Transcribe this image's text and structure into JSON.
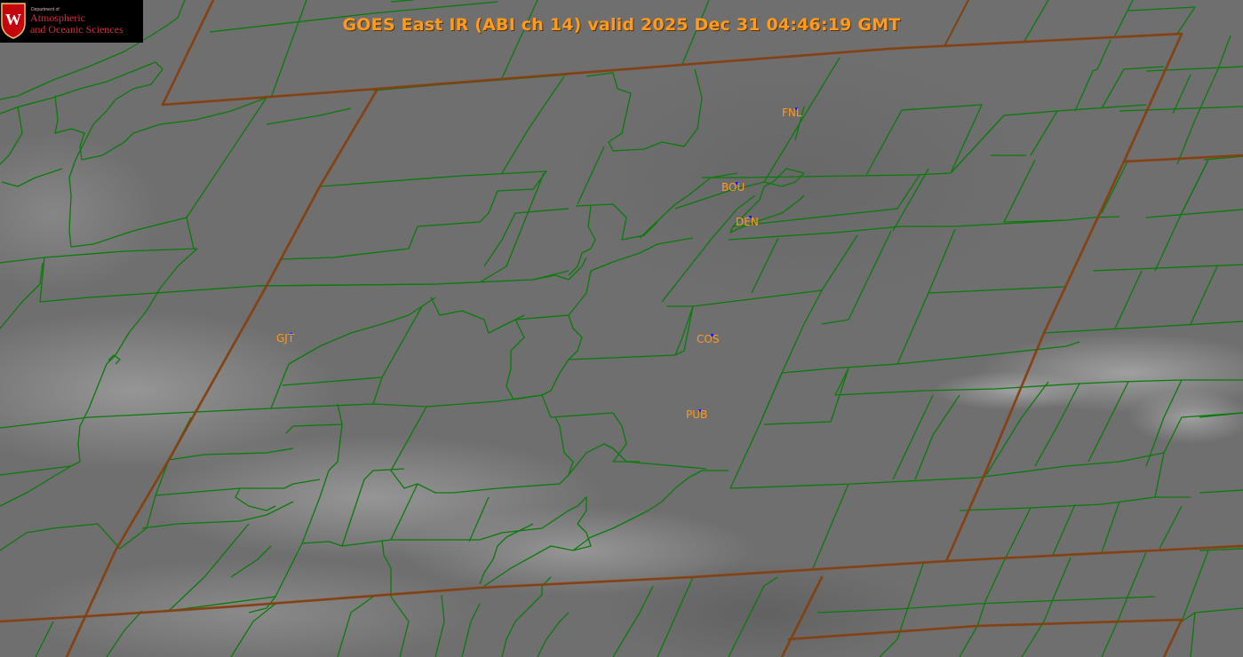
{
  "title": "GOES East IR (ABI ch 14) valid 2025 Dec 31 04:46:19 GMT",
  "logo": {
    "department": "Department of",
    "line1": "Atmospheric",
    "line2": "and Oceanic Sciences"
  },
  "stations": [
    {
      "id": "FNL",
      "label": "FNL"
    },
    {
      "id": "BOU",
      "label": "BOU"
    },
    {
      "id": "DEN",
      "label": "DEN"
    },
    {
      "id": "GJT",
      "label": "GJT"
    },
    {
      "id": "COS",
      "label": "COS"
    },
    {
      "id": "PUB",
      "label": "PUB"
    }
  ],
  "colors": {
    "county_lines": "#0a7a0a",
    "state_lines": "#7a4010",
    "station_labels": "#ff9a1a",
    "station_markers": "#1a1aff",
    "title": "#ff9a1a"
  }
}
